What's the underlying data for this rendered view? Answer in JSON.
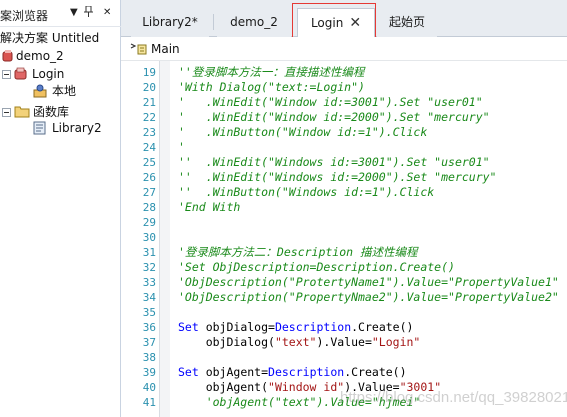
{
  "explorer": {
    "title": "案浏览器",
    "pin_glyph": "▼ ▫ ✕",
    "items": [
      {
        "label": "解决方案 Untitled",
        "icon": "solution-icon"
      },
      {
        "label": "demo_2",
        "icon": "test-icon"
      },
      {
        "label": "Login",
        "icon": "test-red-icon"
      },
      {
        "label": "本地",
        "icon": "local-repository-icon"
      },
      {
        "label": "函数库",
        "icon": "folder-icon"
      },
      {
        "label": "Library2",
        "icon": "library-icon"
      }
    ]
  },
  "tabs": [
    {
      "label": "Library2*",
      "active": false
    },
    {
      "label": "demo_2",
      "active": false
    },
    {
      "label": "Login",
      "active": true,
      "close": "✕"
    },
    {
      "label": "起始页",
      "active": false
    }
  ],
  "actionbar": {
    "label": "Main",
    "icon": "action-icon"
  },
  "colors": {
    "comment": "#1a8a1a",
    "keyword": "#0000ff",
    "string": "#a31515",
    "line_number": "#2b91af",
    "highlight_box": "#e53935"
  },
  "code": [
    {
      "n": "19",
      "segs": [
        {
          "t": "''登录脚本方法一：直接描述性编程",
          "c": "cmt"
        }
      ]
    },
    {
      "n": "20",
      "segs": [
        {
          "t": "'With Dialog(\"text:=Login\")",
          "c": "cmt"
        }
      ]
    },
    {
      "n": "21",
      "segs": [
        {
          "t": "'   .WinEdit(\"Window id:=3001\").Set \"user01\"",
          "c": "cmt"
        }
      ]
    },
    {
      "n": "22",
      "segs": [
        {
          "t": "'   .WinEdit(\"Window id:=2000\").Set \"mercury\"",
          "c": "cmt"
        }
      ]
    },
    {
      "n": "23",
      "segs": [
        {
          "t": "'   .WinButton(\"Window id:=1\").Click",
          "c": "cmt"
        }
      ]
    },
    {
      "n": "24",
      "segs": [
        {
          "t": "'",
          "c": "cmt"
        }
      ]
    },
    {
      "n": "25",
      "segs": [
        {
          "t": "''  .WinEdit(\"Windows id:=3001\").Set \"user01\"",
          "c": "cmt"
        }
      ]
    },
    {
      "n": "26",
      "segs": [
        {
          "t": "''  .WinEdit(\"Windows id:=2000\").Set \"mercury\"",
          "c": "cmt"
        }
      ]
    },
    {
      "n": "27",
      "segs": [
        {
          "t": "''  .WinButton(\"Windows id:=1\").Click",
          "c": "cmt"
        }
      ]
    },
    {
      "n": "28",
      "segs": [
        {
          "t": "'End With",
          "c": "cmt"
        }
      ]
    },
    {
      "n": "29",
      "segs": []
    },
    {
      "n": "30",
      "segs": []
    },
    {
      "n": "31",
      "segs": [
        {
          "t": "'登录脚本方法二：Description 描述性编程",
          "c": "cmt"
        }
      ]
    },
    {
      "n": "32",
      "segs": [
        {
          "t": "'Set ObjDescription=Description.Create()",
          "c": "cmt"
        }
      ]
    },
    {
      "n": "33",
      "segs": [
        {
          "t": "'ObjDescription(\"ProtertyName1\").Value=\"PropertyValue1\"",
          "c": "cmt"
        }
      ]
    },
    {
      "n": "34",
      "segs": [
        {
          "t": "'ObjDescription(\"PropertyNmae2\").Value=\"PropertyValue2\"",
          "c": "cmt"
        }
      ]
    },
    {
      "n": "35",
      "segs": []
    },
    {
      "n": "36",
      "segs": [
        {
          "t": "Set",
          "c": "kw"
        },
        {
          "t": " objDialog=",
          "c": "plain"
        },
        {
          "t": "Description",
          "c": "kw"
        },
        {
          "t": ".Create()",
          "c": "plain"
        }
      ]
    },
    {
      "n": "37",
      "segs": [
        {
          "t": "    objDialog(",
          "c": "plain"
        },
        {
          "t": "\"text\"",
          "c": "str"
        },
        {
          "t": ").Value=",
          "c": "plain"
        },
        {
          "t": "\"Login\"",
          "c": "str"
        }
      ]
    },
    {
      "n": "38",
      "segs": []
    },
    {
      "n": "39",
      "segs": [
        {
          "t": "Set",
          "c": "kw"
        },
        {
          "t": " objAgent=",
          "c": "plain"
        },
        {
          "t": "Description",
          "c": "kw"
        },
        {
          "t": ".Create()",
          "c": "plain"
        }
      ]
    },
    {
      "n": "40",
      "segs": [
        {
          "t": "    objAgent(",
          "c": "plain"
        },
        {
          "t": "\"Window id\"",
          "c": "str"
        },
        {
          "t": ").Value=",
          "c": "plain"
        },
        {
          "t": "\"3001\"",
          "c": "str"
        }
      ]
    },
    {
      "n": "41",
      "segs": [
        {
          "t": "    'objAgent(\"text\").Value=\"hjmei\"",
          "c": "cmt"
        }
      ]
    }
  ],
  "watermark": "https://blog.csdn.net/qq_39828021"
}
